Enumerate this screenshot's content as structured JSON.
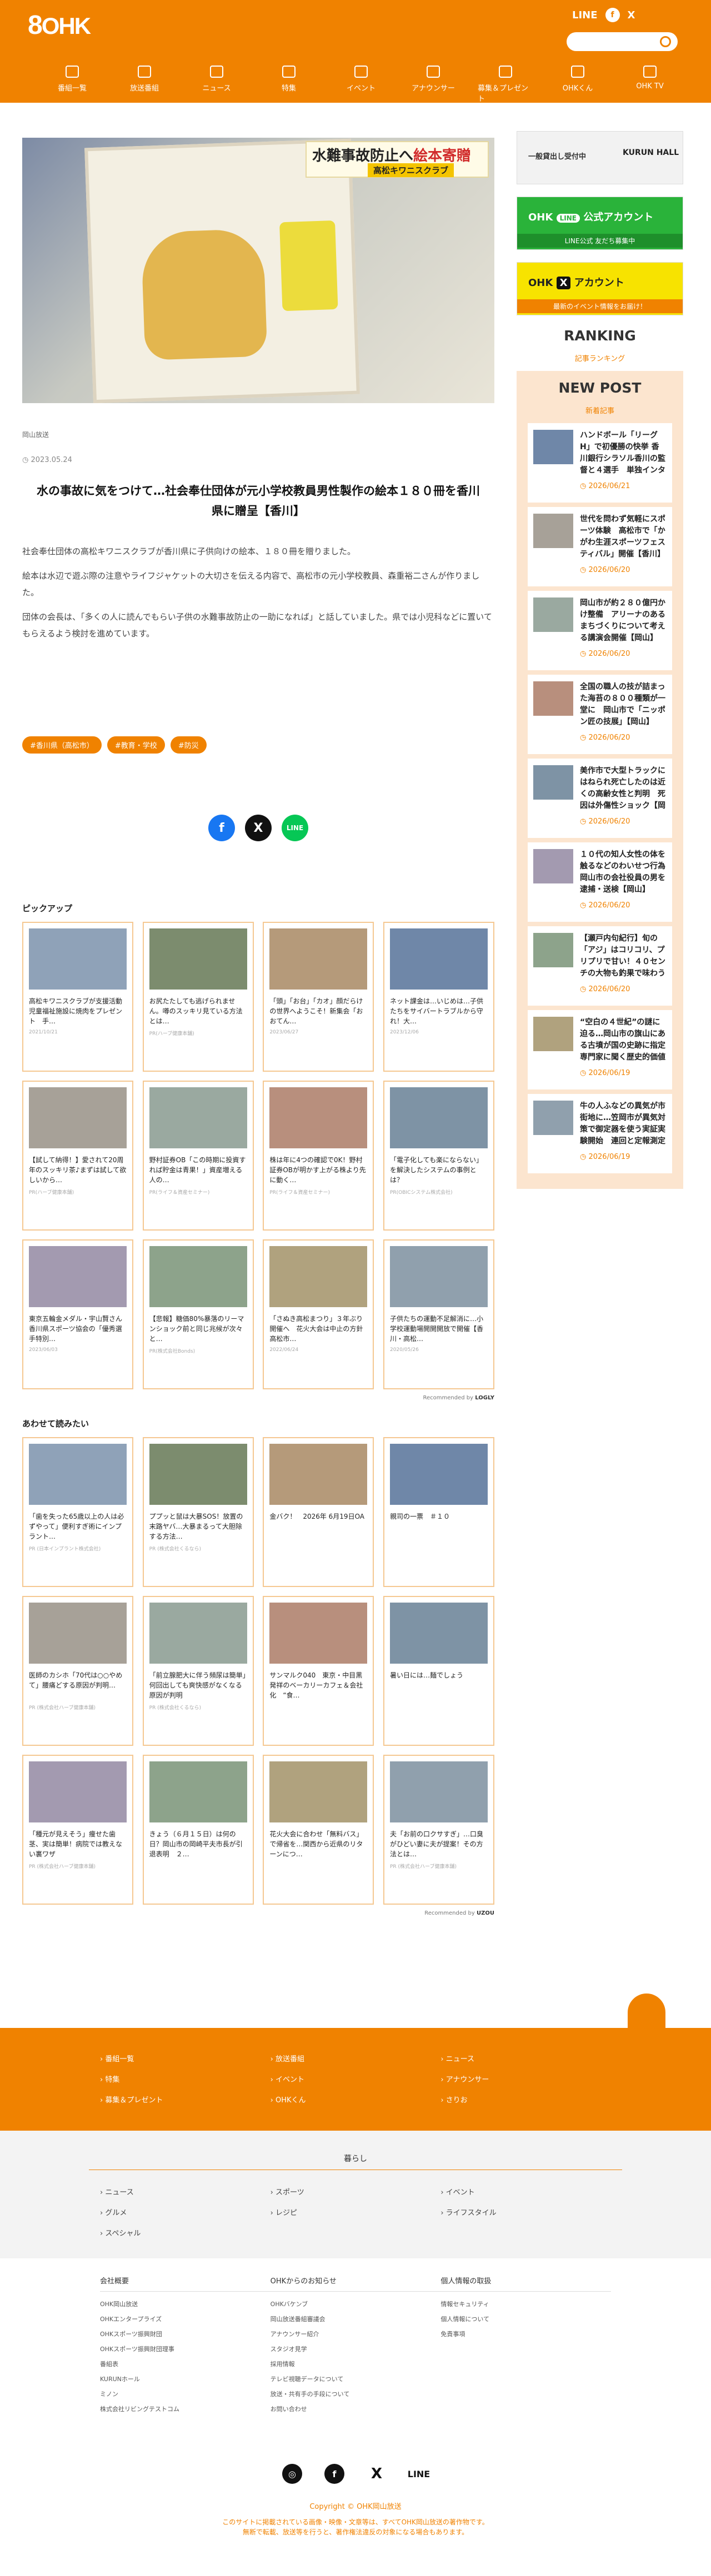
{
  "header": {
    "logo_num": "8",
    "logo_text": "OHK",
    "social": [
      "LINE",
      "f",
      "X"
    ],
    "search_placeholder": ""
  },
  "nav": [
    "番組一覧",
    "放送番組",
    "ニュース",
    "特集",
    "イベント",
    "アナウンサー",
    "募集＆プレゼント",
    "OHKくん",
    "OHK TV"
  ],
  "article": {
    "banner_main": "水難事故防止へ",
    "banner_em": "絵本寄贈",
    "banner_sub": "高松キワニスクラブ",
    "category": "岡山放送",
    "date": "2023.05.24",
    "title": "水の事故に気をつけて…社会奉仕団体が元小学校教員男性製作の絵本１８０冊を香川県に贈呈【香川】",
    "paragraphs": [
      "社会奉仕団体の高松キワニスクラブが香川県に子供向けの絵本、１８０冊を贈りました。",
      "絵本は水辺で遊ぶ際の注意やライフジャケットの大切さを伝える内容で、高松市の元小学校教員、森重裕二さんが作りました。",
      "団体の会長は、「多くの人に読んでもらい子供の水難事故防止の一助になれば」と話していました。県では小児科などに置いてもらえるよう検討を進めています。"
    ],
    "tags": [
      "#香川県（高松市）",
      "#教育・学校",
      "#防災"
    ]
  },
  "pickup": {
    "title": "ピックアップ",
    "items": [
      {
        "title": "高松キワニスクラブが支援活動　児童福祉施設に焼肉をプレゼント　手…",
        "meta": "2021/10/21"
      },
      {
        "title": "お尻たたしても逃げられません。噂のスッキリ見ている方法とは…",
        "meta": "PR(ハーブ健康本舗)"
      },
      {
        "title": "「頭」「お台」「カオ」顔だらけの世界へようこそ！新集会「おおてん…",
        "meta": "2023/06/27"
      },
      {
        "title": "ネット課金は…いじめは…子供たちをサイバートラブルから守れ！大…",
        "meta": "2023/12/06"
      },
      {
        "title": "【試して納得！】愛されて20周年のスッキリ茶♪まずは試して欲しいから…",
        "meta": "PR(ハーブ健康本舗)"
      },
      {
        "title": "野村証券OB「この時期に投資すれば貯金は青果！」資産増える人の…",
        "meta": "PR(ライフ＆資産セミナー)"
      },
      {
        "title": "株は年に4つの確認で0K！野村証券OBが明かす上がる株より先に動く…",
        "meta": "PR(ライフ＆資産セミナー)"
      },
      {
        "title": "「電子化しても楽にならない」を解決したシステムの事例とは？",
        "meta": "PR(OBICシステム株式会社)"
      },
      {
        "title": "東京五輪金メダル・宇山賢さん　香川県スポーツ協会の「優秀選手特別…",
        "meta": "2023/06/03"
      },
      {
        "title": "【悲報】糖価80%暴落のリーマンショック前と同じ兆候が次々と…",
        "meta": "PR(株式会社Bonds)"
      },
      {
        "title": "「さぬき高松まつり」３年ぶり開催へ　花火大会は中止の方針　高松市…",
        "meta": "2022/06/24"
      },
      {
        "title": "子供たちの運動不足解消に…小学校運動場開開開放で開催【香川・高松…",
        "meta": "2020/05/26"
      }
    ],
    "reco": "Recommended by",
    "reco_brand": "LOGLY"
  },
  "related": {
    "title": "あわせて読みたい",
    "items": [
      {
        "title": "「歯を失った65歳以上の人は必ずやって」便利すぎ術にインプラント…",
        "meta": "PR (日本インプラント株式会社)"
      },
      {
        "title": "ププッと鼠は大暴SOS！放置の末路ヤバ…大暴まるって大胆除する方法…",
        "meta": "PR (株式会社くるなら)"
      },
      {
        "title": "金バク！　2026年 6月19日OA",
        "meta": ""
      },
      {
        "title": "親司の一票　＃１０",
        "meta": ""
      },
      {
        "title": "医師のカシホ「70代は○○やめて」腰痛どする原因が判明…",
        "meta": "PR (株式会社ハーブ健康本舗)"
      },
      {
        "title": "「前立腺肥大に伴う頻尿は簡単」何回出しても爽快感がなくなる原因が判明",
        "meta": "PR (株式会社くるなら)"
      },
      {
        "title": "サンマルク040　東京・中目黒発祥のベーカリーカフェ＆会社化　“食…",
        "meta": ""
      },
      {
        "title": "暑い日には…麺でしょう",
        "meta": ""
      },
      {
        "title": "「種元が見えそう」痩せた歯茎、実は簡単！病院では教えない裏ワザ",
        "meta": "PR (株式会社ハーブ健康本舗)"
      },
      {
        "title": "きょう（６月１５日）は何の日？岡山市の岡崎平夫市長が引退表明　２…",
        "meta": ""
      },
      {
        "title": "花火大会に合わせ「無料バス」で帰省を…関西から近県のリターンにつ…",
        "meta": ""
      },
      {
        "title": "夫「お前の口クサすぎ」…口臭がひどい妻に夫が提案！その方法とは…",
        "meta": "PR (株式会社ハーブ健康本舗)"
      }
    ],
    "reco": "Recommended by",
    "reco_brand": "UZOU"
  },
  "sidebar": {
    "ad1_text": "一般貸出し受付中",
    "ad1_brand": "KURUN HALL",
    "ad2_text": "公式アカウント",
    "ad2_sub": "LINE公式 友だち募集中",
    "ad3_text": "アカウント",
    "ad3_sub": "最新のイベント情報をお届け！",
    "ranking_title": "RANKING",
    "ranking_sub": "記事ランキング",
    "newpost_title": "NEW POST",
    "newpost_sub": "新着記事",
    "posts": [
      {
        "title": "ハンドボール「リーグH」で初優勝の快挙 香川銀行シラソル香川の監督と４選手　単独インタビュー【香川】",
        "date": "2026/06/21"
      },
      {
        "title": "世代を問わず気軽にスポーツ体験　高松市で「かがわ生涯スポーツフェスティバル」開催【香川】",
        "date": "2026/06/20"
      },
      {
        "title": "岡山市が約２８０億円かけ整備　アリーナのあるまちづくりについて考える講演会開催【岡山】",
        "date": "2026/06/20"
      },
      {
        "title": "全国の職人の技が詰まった海苔の８００種類が一堂に　岡山市で「ニッポン匠の技展」【岡山】",
        "date": "2026/06/20"
      },
      {
        "title": "美作市で大型トラックにはねられ死亡したのは近くの高齢女性と判明　死因は外傷性ショック【岡山】",
        "date": "2026/06/20"
      },
      {
        "title": "１０代の知人女性の体を触るなどのわいせつ行為　岡山市の会社役員の男を逮捕・送検【岡山】",
        "date": "2026/06/20"
      },
      {
        "title": "【瀬戸内句紀行】旬の「アジ」はコリコリ、プリプリで甘い！４０センチの大物も釣果で味わう【岡山・倉敷】",
        "date": "2026/06/20"
      },
      {
        "title": "“空白の４世紀”の謎に迫る…岡山市の旗山にある古墳が国の史跡に指定　専門家に聞く歴史的価値【岡山】",
        "date": "2026/06/19"
      },
      {
        "title": "牛の人ふなどの異気が市街地に…笠岡市が異気対策で御定器を使う実証実験開始　連回と定報測定へ【岡山】",
        "date": "2026/06/19"
      }
    ]
  },
  "footer": {
    "main_links": [
      "番組一覧",
      "放送番組",
      "ニュース",
      "特集",
      "イベント",
      "アナウンサー",
      "募集＆プレゼント",
      "OHKくん",
      "さりお"
    ],
    "kurashi_title": "暮らし",
    "kurashi_links": [
      "ニュース",
      "スポーツ",
      "イベント",
      "グルメ",
      "レジピ",
      "ライフスタイル",
      "スペシャル"
    ],
    "col1_title": "会社概要",
    "col1": [
      "OHK岡山放送",
      "OHKエンタープライズ",
      "OHKスポーツ振興財団",
      "OHKスポーツ振興財団理事",
      "番組表",
      "KURUNホール",
      "ミノン",
      "株式会社リビングテストコム"
    ],
    "col2_title": "OHKからのお知らせ",
    "col2": [
      "OHKバケンブ",
      "岡山放送番組審議会",
      "アナウンサー紹介",
      "スタジオ見学",
      "採用情報",
      "テレビ視聴データについて",
      "放送・共有手の手段について",
      "お問い合わせ"
    ],
    "col3_title": "個人情報の取扱",
    "col3": [
      "情報セキュリティ",
      "個人情報について",
      "免責事項"
    ],
    "social": [
      "◎",
      "f",
      "X",
      "LINE"
    ],
    "copyright": "Copyright © OHK岡山放送",
    "notice1": "このサイトに掲載されている画像・映像・文章等は、すべてOHK岡山放送の著作物です。",
    "notice2": "無断で転載、放送等を行うと、著作権法違反の対象になる場合もあります。"
  }
}
